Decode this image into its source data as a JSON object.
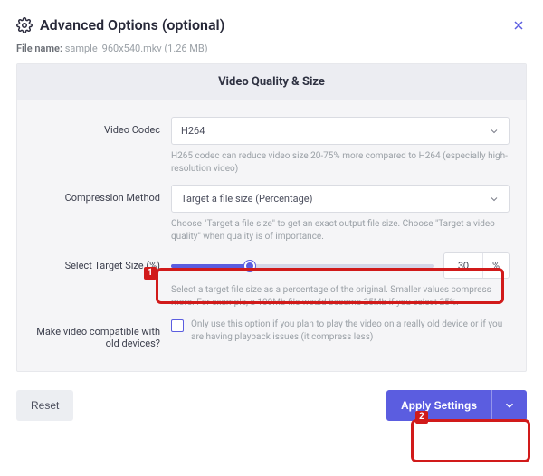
{
  "title": "Advanced Options (optional)",
  "filename_label": "File name:",
  "filename_value": "sample_960x540.mkv (1.26 MB)",
  "panel_title": "Video Quality & Size",
  "codec": {
    "label": "Video Codec",
    "value": "H264",
    "hint": "H265 codec can reduce video size 20-75% more compared to H264 (especially high-resolution video)"
  },
  "compression": {
    "label": "Compression Method",
    "value": "Target a file size (Percentage)",
    "hint": "Choose \"Target a file size\" to get an exact output file size. Choose \"Target a video quality\" when quality is of importance."
  },
  "target": {
    "label": "Select Target Size (%)",
    "value": "30",
    "unit": "%",
    "hint": "Select a target file size as a percentage of the original. Smaller values compress more. For example, a 100Mb file would become 25Mb if you select 25%."
  },
  "compat": {
    "label": "Make video compatible with old devices?",
    "hint": "Only use this option if you plan to play the video on a really old device or if you are having playback issues (it compress less)"
  },
  "buttons": {
    "reset": "Reset",
    "apply": "Apply Settings"
  },
  "callouts": {
    "c1": "1",
    "c2": "2"
  }
}
